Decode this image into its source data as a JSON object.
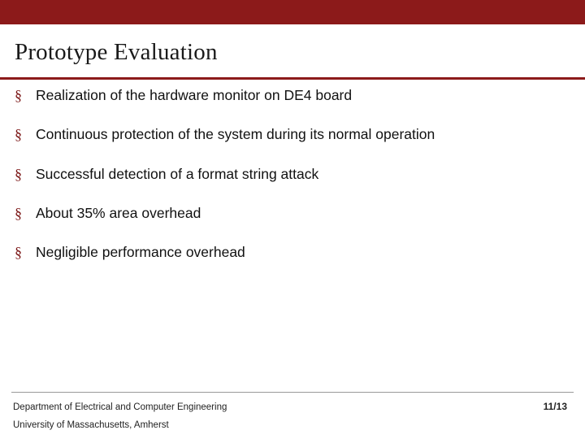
{
  "slide": {
    "title": "Prototype Evaluation",
    "accent_color": "#8C1A1A",
    "bullet_marker": "§",
    "bullets": [
      {
        "text": "Realization of the hardware monitor on DE4 board",
        "justify": false
      },
      {
        "text": "Continuous protection of the system during its normal operation",
        "justify": true
      },
      {
        "text": "Successful detection of a format string attack",
        "justify": false
      },
      {
        "text": "About 35% area overhead",
        "justify": false
      },
      {
        "text": "Negligible performance overhead",
        "justify": false
      }
    ],
    "footer": {
      "line1": "Department of Electrical and Computer Engineering",
      "line2": "University of Massachusetts, Amherst",
      "page_number": "11/13"
    }
  }
}
